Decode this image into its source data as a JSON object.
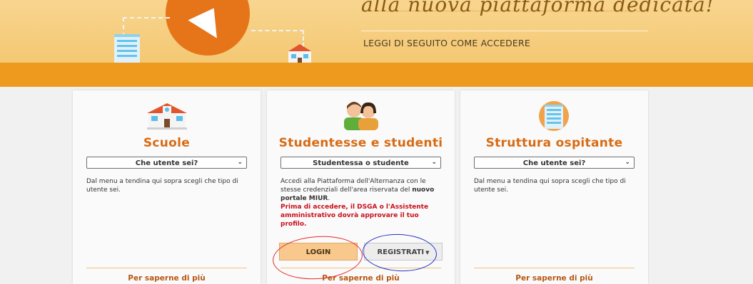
{
  "banner": {
    "tagline": "alla nuova piattaforma dedicata!",
    "subtitle": "LEGGI DI SEGUITO COME ACCEDERE"
  },
  "cards": [
    {
      "icon": "school-building-icon",
      "title": "Scuole",
      "select_value": "Che utente sei?",
      "description": "Dal menu a tendina qui sopra scegli che tipo di utente sei.",
      "more_link": "Per saperne di più"
    },
    {
      "icon": "students-icon",
      "title": "Studentesse e studenti",
      "select_value": "Studentessa o studente",
      "description_pre": "Accedi alla Piattaforma dell'Alternanza con le stesse credenziali dell'area riservata del ",
      "description_bold": "nuovo portale MIUR",
      "description_post": ".",
      "warning": "Prima di accedere, il DSGA o l'Assistente amministrativo dovrà approvare il tuo profilo.",
      "login_label": "LOGIN",
      "register_label": "REGISTRATI",
      "more_link": "Per saperne di più"
    },
    {
      "icon": "office-building-icon",
      "title": "Struttura ospitante",
      "select_value": "Che utente sei?",
      "description": "Dal menu a tendina qui sopra scegli che tipo di utente sei.",
      "more_link": "Per saperne di più"
    }
  ],
  "colors": {
    "banner": "#f6cd7f",
    "banner_strip": "#ed9a1f",
    "accent": "#d86b14",
    "warning": "#c8101c",
    "login_button": "#f8c88d"
  }
}
